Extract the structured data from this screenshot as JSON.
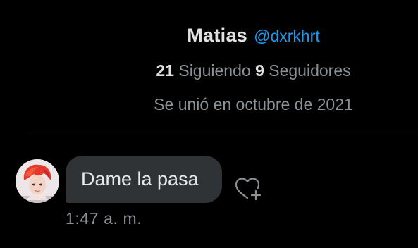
{
  "profile": {
    "display_name": "Matias",
    "handle": "@dxrkhrt",
    "following_count": "21",
    "following_label": "Siguiendo",
    "followers_count": "9",
    "followers_label": "Seguidores",
    "joined": "Se unió en octubre de 2021"
  },
  "message": {
    "text": "Dame la pasa",
    "timestamp": "1:47 a. m.",
    "react_icon": "heart-plus-icon"
  },
  "colors": {
    "background": "#000000",
    "handle": "#1d9bf0",
    "bubble": "#2f3336",
    "muted_text": "#8b9196",
    "divider": "#2f3336"
  }
}
